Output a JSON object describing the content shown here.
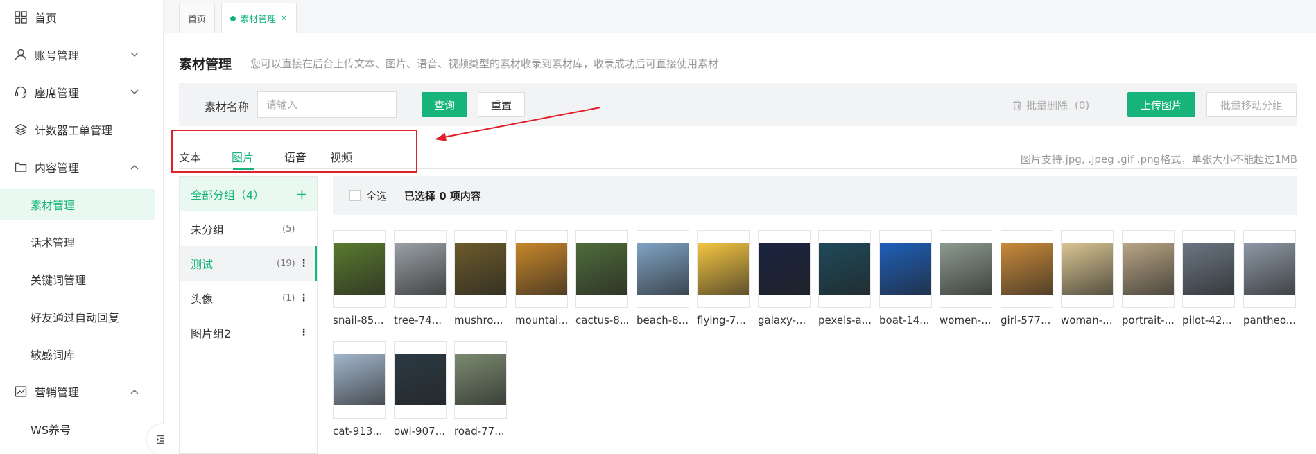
{
  "sidebar": {
    "items": [
      {
        "label": "首页",
        "icon": "home-grid-icon",
        "chevron": ""
      },
      {
        "label": "账号管理",
        "icon": "user-icon",
        "chevron": "down"
      },
      {
        "label": "座席管理",
        "icon": "headset-icon",
        "chevron": "down"
      },
      {
        "label": "计数器工单管理",
        "icon": "layers-icon",
        "chevron": ""
      },
      {
        "label": "内容管理",
        "icon": "folder-icon",
        "chevron": "up"
      }
    ],
    "sub_items": [
      "素材管理",
      "话术管理",
      "关键词管理",
      "好友通过自动回复",
      "敏感词库"
    ],
    "marketing": {
      "label": "营销管理",
      "icon": "chart-icon",
      "chevron": "up"
    },
    "marketing_sub": [
      "WS养号"
    ]
  },
  "page_tabs": [
    {
      "label": "首页"
    },
    {
      "label": "素材管理",
      "close": "×"
    }
  ],
  "header": {
    "title": "素材管理",
    "description": "您可以直接在后台上传文本、图片、语音、视频类型的素材收录到素材库，收录成功后可直接使用素材"
  },
  "filter": {
    "label": "素材名称",
    "placeholder": "请输入",
    "query": "查询",
    "reset": "重置",
    "batch_delete": "批量删除",
    "batch_delete_count": "(0)",
    "upload": "上传图片",
    "batch_move": "批量移动分组"
  },
  "type_tabs": [
    "文本",
    "图片",
    "语音",
    "视频"
  ],
  "tip": "图片支持.jpg, .jpeg .gif .png格式，单张大小不能超过1MB",
  "groups": [
    {
      "label": "全部分组（4）",
      "count": "",
      "more": ""
    },
    {
      "label": "未分组",
      "count": "(5)",
      "more": ""
    },
    {
      "label": "测试",
      "count": "(19)",
      "more": "⋮"
    },
    {
      "label": "头像",
      "count": "(1)",
      "more": "⋮"
    },
    {
      "label": "图片组2",
      "count": "",
      "more": "⋮"
    }
  ],
  "selection": {
    "select_all": "全选",
    "selected_text": "已选择 0 项内容"
  },
  "images": [
    {
      "name": "snail-85...",
      "color": "#5a7a2e"
    },
    {
      "name": "tree-74...",
      "color": "#9aa0a5"
    },
    {
      "name": "mushro...",
      "color": "#6b5a2a"
    },
    {
      "name": "mountai...",
      "color": "#c7862a"
    },
    {
      "name": "cactus-8...",
      "color": "#4f6b3a"
    },
    {
      "name": "beach-8...",
      "color": "#7fa3c4"
    },
    {
      "name": "flying-7...",
      "color": "#f4c542"
    },
    {
      "name": "galaxy-...",
      "color": "#1a2440"
    },
    {
      "name": "pexels-a...",
      "color": "#1f4a5a"
    },
    {
      "name": "boat-14...",
      "color": "#1e5fb8"
    },
    {
      "name": "women-...",
      "color": "#8c9a8f"
    },
    {
      "name": "girl-577...",
      "color": "#c98a3a"
    },
    {
      "name": "woman-...",
      "color": "#d9c592"
    },
    {
      "name": "portrait-...",
      "color": "#b8a585"
    },
    {
      "name": "pilot-42...",
      "color": "#6b7682"
    },
    {
      "name": "pantheo...",
      "color": "#8d98a5"
    },
    {
      "name": "cat-913...",
      "color": "#a3b6cc"
    },
    {
      "name": "owl-907...",
      "color": "#2c3a44"
    },
    {
      "name": "road-77...",
      "color": "#7a8a70"
    }
  ],
  "colors": {
    "accent": "#16b47a",
    "annotation": "#e0202a"
  }
}
